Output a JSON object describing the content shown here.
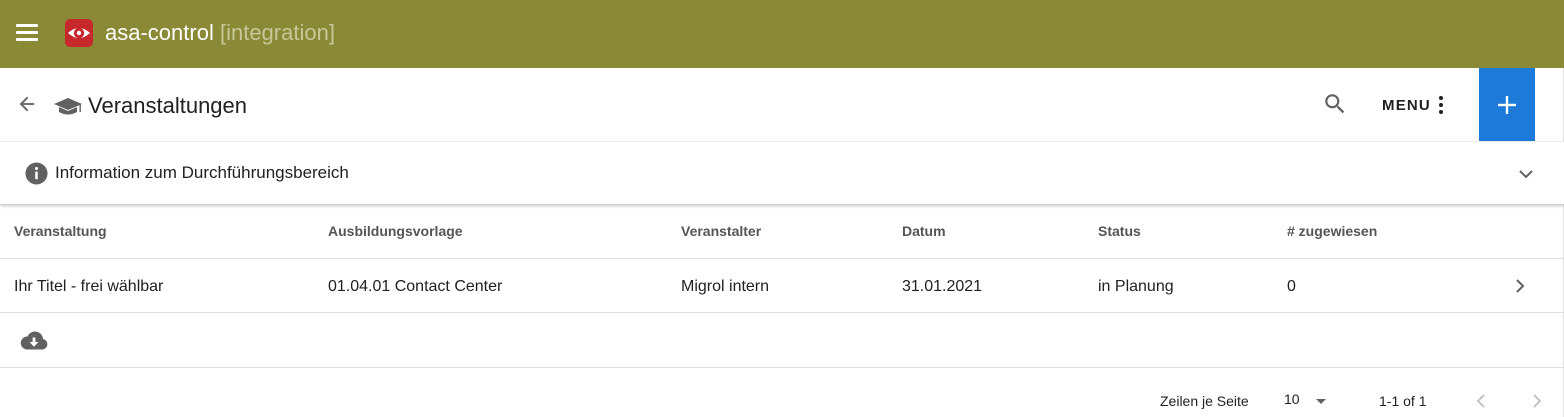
{
  "app": {
    "name": "asa-control",
    "environment": "[integration]",
    "colors": {
      "topbar": "#8a8935",
      "accent": "#1e7ad8"
    },
    "icons": {
      "menu": "hamburger-icon",
      "logo": "eye-logo"
    }
  },
  "header": {
    "title": "Veranstaltungen",
    "menu_label": "MENU",
    "icons": {
      "back": "arrow-left-icon",
      "title": "graduation-cap-icon",
      "search": "search-icon",
      "menu": "more-vert-icon",
      "add": "plus-icon"
    }
  },
  "info_panel": {
    "label": "Information zum Durchführungsbereich",
    "expanded": false,
    "icons": {
      "info": "info-icon",
      "toggle": "chevron-down-icon"
    }
  },
  "table": {
    "columns": [
      "Veranstaltung",
      "Ausbildungsvorlage",
      "Veranstalter",
      "Datum",
      "Status",
      "# zugewiesen"
    ],
    "rows": [
      [
        "Ihr Titel - frei wählbar",
        "01.04.01 Contact Center",
        "Migrol intern",
        "31.01.2021",
        "in Planung",
        "0"
      ]
    ]
  },
  "export": {
    "icon": "cloud-download-icon"
  },
  "pagination": {
    "rows_per_page_label": "Zeilen je Seite",
    "rows_per_page_value": "10",
    "range": "1-1 of 1",
    "icons": {
      "prev": "chevron-left-icon",
      "next": "chevron-right-icon"
    }
  }
}
